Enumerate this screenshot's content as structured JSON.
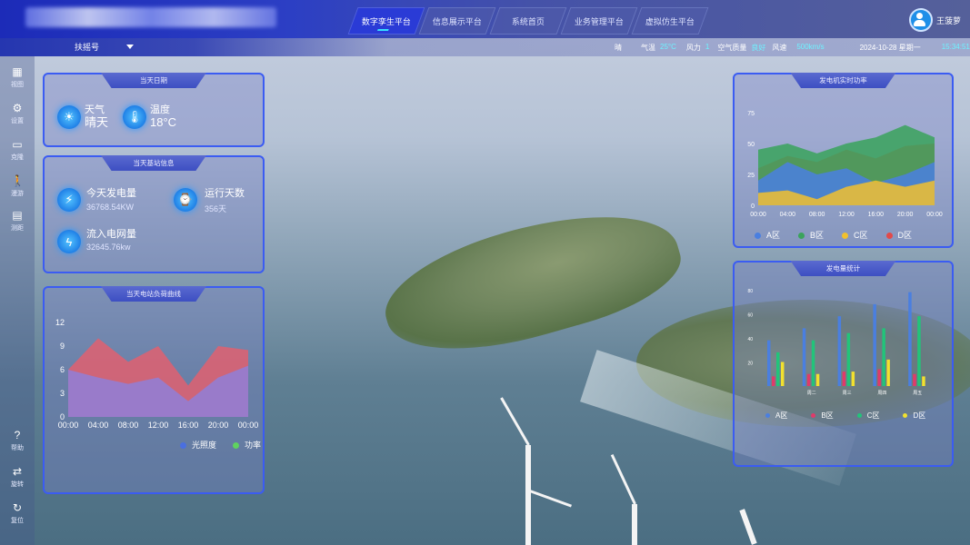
{
  "header": {
    "nav_tabs": [
      "数字孪生平台",
      "信息展示平台",
      "系统首页",
      "业务管理平台",
      "虚拟仿生平台"
    ],
    "user_name": "王菠萝"
  },
  "subbar": {
    "selector_label": "扶摇号",
    "weather_labels": {
      "sky": "晴",
      "temp": "气温",
      "wind": "风力",
      "air": "空气质量",
      "speed": "风速"
    },
    "temp_value": "25°C",
    "wind_value": "1",
    "air_value": "良好",
    "speed_value": "500km/s",
    "date": "2024-10-28 星期一",
    "time": "15:34:51"
  },
  "rail": [
    "视图",
    "设置",
    "克隆",
    "漫游",
    "测距",
    "帮助",
    "旋转",
    "复位"
  ],
  "panel_today": {
    "title": "当天日期",
    "weather_label": "天气",
    "weather_value": "晴天",
    "temp_label": "温度",
    "temp_value": "18°C"
  },
  "panel_station": {
    "title": "当天基站信息",
    "gen_label": "今天发电量",
    "gen_value": "36768.54KW",
    "days_label": "运行天数",
    "days_value": "356天",
    "grid_label": "流入电网量",
    "grid_value": "32645.76kw"
  },
  "colors": {
    "accent": "#3b5cf2",
    "blue": "#4a7fe0",
    "green": "#3aa35c",
    "yellow": "#f2c12e",
    "red": "#e24a4a",
    "pink": "#e03a6a"
  },
  "chart_data": [
    {
      "type": "area",
      "title": "当天电站负荷曲线",
      "x": [
        "00:00",
        "04:00",
        "08:00",
        "12:00",
        "16:00",
        "20:00",
        "00:00"
      ],
      "ylim": [
        0,
        12
      ],
      "yticks": [
        0,
        3,
        6,
        9,
        12
      ],
      "series": [
        {
          "name": "光照度",
          "values": [
            6,
            5,
            4.2,
            5,
            2,
            5,
            6.5
          ],
          "color": "#8f7fd8"
        },
        {
          "name": "功率",
          "values": [
            6,
            10,
            7,
            9,
            4,
            9,
            8.5
          ],
          "color": "#e06070"
        }
      ],
      "legend": "bottom-right"
    },
    {
      "type": "area",
      "title": "发电机实时功率",
      "x": [
        "00:00",
        "04:00",
        "08:00",
        "12:00",
        "16:00",
        "20:00",
        "00:00"
      ],
      "ylim": [
        0,
        75
      ],
      "yticks": [
        0,
        25,
        50,
        75
      ],
      "series": [
        {
          "name": "A区",
          "values": [
            20,
            35,
            25,
            30,
            18,
            25,
            35
          ],
          "color": "#4a7fe0"
        },
        {
          "name": "B区",
          "values": [
            45,
            50,
            42,
            50,
            55,
            65,
            55
          ],
          "color": "#3aa35c"
        },
        {
          "name": "C区",
          "values": [
            10,
            12,
            5,
            15,
            20,
            15,
            20
          ],
          "color": "#f2c12e"
        },
        {
          "name": "D区",
          "values": [
            30,
            40,
            35,
            45,
            38,
            48,
            50
          ],
          "color": "#e24a4a"
        }
      ],
      "legend": "bottom"
    },
    {
      "type": "bar",
      "title": "发电量统计",
      "categories": [
        "",
        "周二",
        "周三",
        "周四",
        "周五"
      ],
      "ylim": [
        0,
        80
      ],
      "yticks": [
        20,
        40,
        60,
        80
      ],
      "series": [
        {
          "name": "A区",
          "values": [
            38,
            48,
            58,
            68,
            78
          ],
          "color": "#4a7fe0"
        },
        {
          "name": "B区",
          "values": [
            8,
            10,
            12,
            14,
            10
          ],
          "color": "#e03a6a"
        },
        {
          "name": "C区",
          "values": [
            28,
            38,
            44,
            48,
            58
          ],
          "color": "#22c47a"
        },
        {
          "name": "D区",
          "values": [
            20,
            10,
            12,
            22,
            8
          ],
          "color": "#f2e12e"
        }
      ],
      "legend": "bottom"
    }
  ]
}
